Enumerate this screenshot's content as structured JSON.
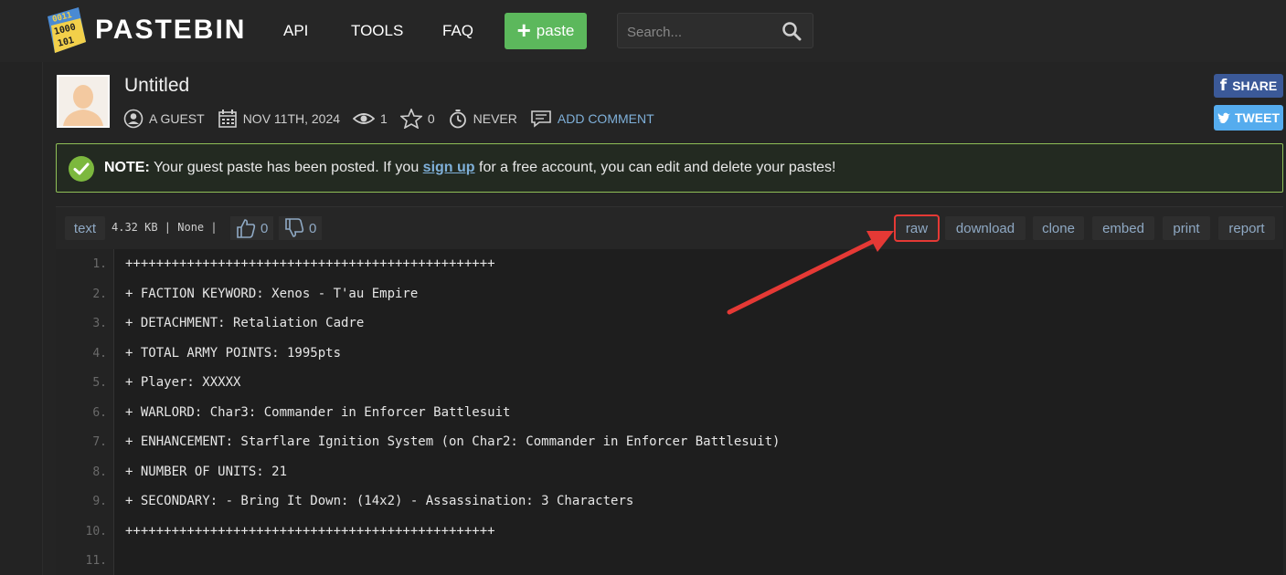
{
  "header": {
    "logo_text": "PASTEBIN",
    "logo_icon_digits": [
      "0011",
      "1000",
      "101"
    ],
    "nav": [
      "API",
      "TOOLS",
      "FAQ"
    ],
    "paste_button": "paste",
    "search_placeholder": "Search..."
  },
  "paste": {
    "title": "Untitled",
    "author": "A GUEST",
    "date": "NOV 11TH, 2024",
    "views": "1",
    "stars": "0",
    "expiry": "NEVER",
    "add_comment": "ADD COMMENT"
  },
  "social": {
    "share": "SHARE",
    "tweet": "TWEET"
  },
  "notice": {
    "label": "NOTE:",
    "text_before": " Your guest paste has been posted. If you ",
    "link": "sign up",
    "text_after": " for a free account, you can edit and delete your pastes!"
  },
  "toolbar": {
    "syntax": "text",
    "info": "4.32 KB | None |",
    "likes": "0",
    "dislikes": "0",
    "actions": [
      "raw",
      "download",
      "clone",
      "embed",
      "print",
      "report"
    ]
  },
  "code_lines": [
    {
      "num": "1.",
      "text": "++++++++++++++++++++++++++++++++++++++++++++++++"
    },
    {
      "num": "2.",
      "text": "+ FACTION KEYWORD: Xenos - T'au Empire"
    },
    {
      "num": "3.",
      "text": "+ DETACHMENT: Retaliation Cadre"
    },
    {
      "num": "4.",
      "text": "+ TOTAL ARMY POINTS: 1995pts"
    },
    {
      "num": "5.",
      "text": "+ Player: XXXXX"
    },
    {
      "num": "6.",
      "text": "+ WARLORD: Char3: Commander in Enforcer Battlesuit"
    },
    {
      "num": "7.",
      "text": "+ ENHANCEMENT: Starflare Ignition System (on Char2: Commander in Enforcer Battlesuit)"
    },
    {
      "num": "8.",
      "text": "+ NUMBER OF UNITS: 21"
    },
    {
      "num": "9.",
      "text": "+ SECONDARY: - Bring It Down: (14x2) - Assassination: 3 Characters"
    },
    {
      "num": "10.",
      "text": "++++++++++++++++++++++++++++++++++++++++++++++++"
    },
    {
      "num": "11.",
      "text": ""
    }
  ],
  "colors": {
    "background": "#1f1f1f",
    "accent_green": "#5cb85c",
    "link_blue": "#7fb0d9",
    "highlight_red": "#e53935",
    "facebook": "#3b5998",
    "twitter": "#55acee"
  }
}
